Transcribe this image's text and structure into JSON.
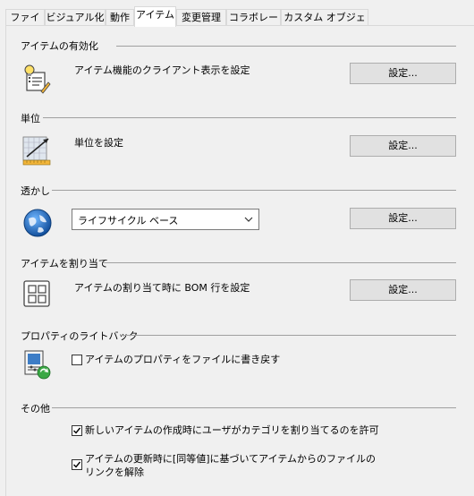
{
  "tabs": [
    {
      "label": "ファイル"
    },
    {
      "label": "ビジュアル化"
    },
    {
      "label": "動作"
    },
    {
      "label": "アイテム"
    },
    {
      "label": "変更管理"
    },
    {
      "label": "コラボレート"
    },
    {
      "label": "カスタム オブジェクト"
    }
  ],
  "active_tab": "アイテム",
  "sections": {
    "enable": {
      "title": "アイテムの有効化",
      "desc": "アイテム機能のクライアント表示を設定",
      "button": "設定..."
    },
    "units": {
      "title": "単位",
      "desc": "単位を設定",
      "button": "設定..."
    },
    "watermark": {
      "title": "透かし",
      "dropdown_value": "ライフサイクル ベース",
      "button": "設定..."
    },
    "assign": {
      "title": "アイテムを割り当て",
      "desc": "アイテムの割り当て時に BOM 行を設定",
      "button": "設定..."
    },
    "writeback": {
      "title": "プロパティのライトバック",
      "checkbox_label": "アイテムのプロパティをファイルに書き戻す",
      "checked": false
    },
    "other": {
      "title": "その他",
      "checkbox1_label": "新しいアイテムの作成時にユーザがカテゴリを割り当てるのを許可",
      "checkbox1_checked": true,
      "checkbox2_line1": "アイテムの更新時に[同等値]に基づいてアイテムからのファイルの",
      "checkbox2_line2": "リンクを解除",
      "checkbox2_checked": true
    }
  }
}
